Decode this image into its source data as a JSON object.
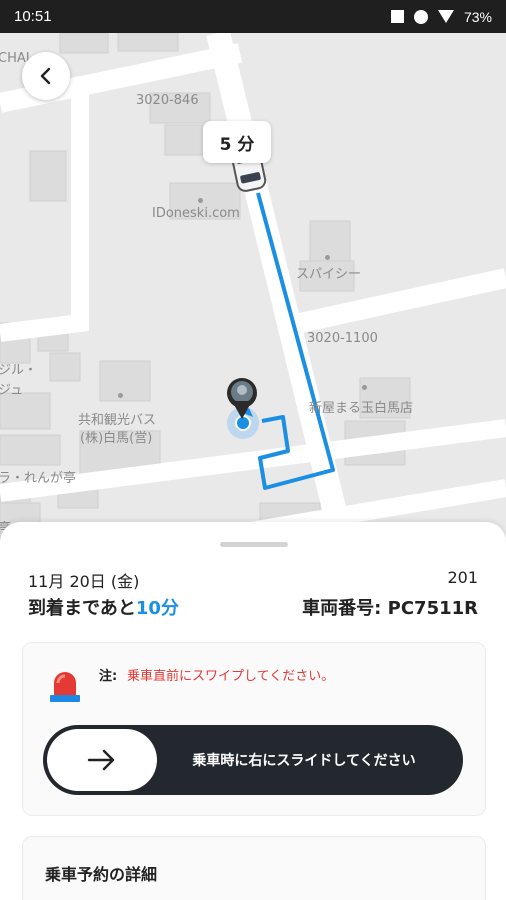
{
  "status_bar": {
    "time": "10:51",
    "battery": "73%"
  },
  "map": {
    "labels": {
      "edge_left": "CHAI",
      "addr_top": "3020-846",
      "website": "IDoneski.com",
      "spicy": "スパイシー",
      "addr_mid": "3020-1100",
      "bus_line1": "共和観光バス",
      "bus_line2": "(株)白馬(営)",
      "shop_right": "新屋まる玉白馬店",
      "left_a": "ジル・",
      "left_b": "ジュ",
      "left_c": "ラ・れんが亭",
      "left_d": "亭"
    },
    "eta": "5 分",
    "route_color": "#1a8fe3"
  },
  "sheet": {
    "date": "11月 20日 (金)",
    "room": "201",
    "arrival_prefix": "到着まであと",
    "arrival_minutes": "10分",
    "vehicle": "車両番号: PC7511R",
    "note_label": "注:",
    "note_text": "乗車直前にスワイプしてください。",
    "slider_text": "乗車時に右にスライドしてください",
    "details_title": "乗車予約の詳細"
  }
}
